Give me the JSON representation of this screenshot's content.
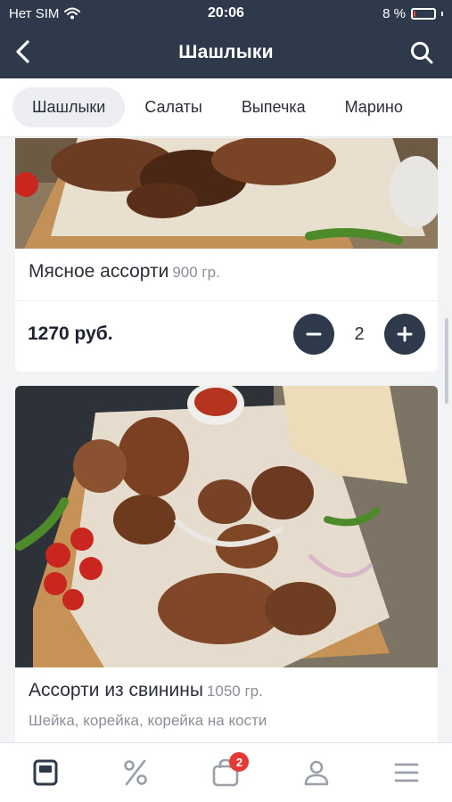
{
  "status": {
    "carrier": "Нет SIM",
    "time": "20:06",
    "battery_label": "8 %",
    "battery_level": 0.08
  },
  "header": {
    "title": "Шашлыки",
    "back_icon": "chevron-left-icon",
    "search_icon": "search-icon"
  },
  "tabs": [
    {
      "label": "Шашлыки",
      "active": true
    },
    {
      "label": "Салаты",
      "active": false
    },
    {
      "label": "Выпечка",
      "active": false
    },
    {
      "label": "Марино",
      "active": false
    }
  ],
  "products": [
    {
      "name": "Мясное ассорти",
      "weight": "900 гр.",
      "price": "1270 руб.",
      "quantity": "2"
    },
    {
      "name": "Ассорти из свинины",
      "weight": "1050 гр.",
      "description": "Шейка, корейка, корейка на кости"
    }
  ],
  "bottom_nav": {
    "items": [
      "menu-icon",
      "discount-icon",
      "cart-icon",
      "profile-icon",
      "more-icon"
    ],
    "cart_badge": "2"
  },
  "colors": {
    "header": "#2e3a4b",
    "accent_button": "#2e3a4b",
    "badge": "#e53935"
  }
}
